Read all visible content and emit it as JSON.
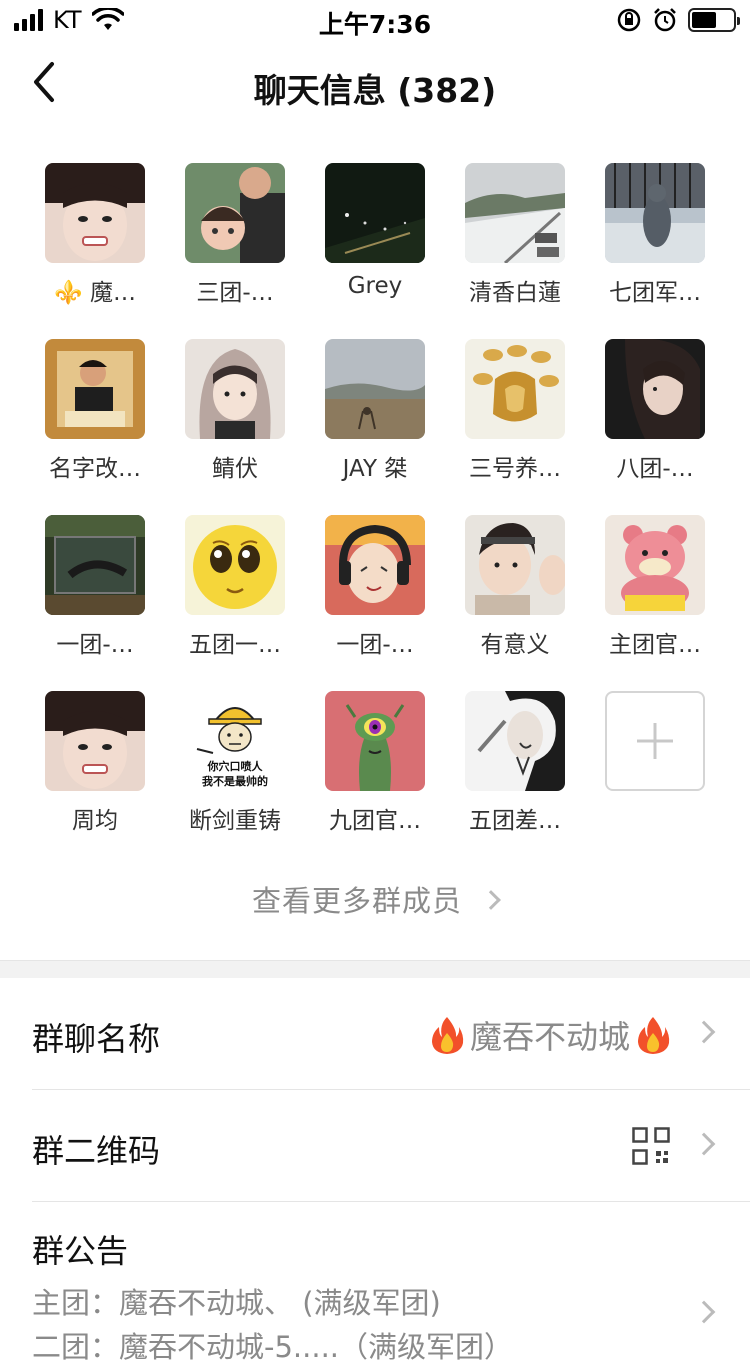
{
  "status_bar": {
    "carrier": "KT",
    "time": "上午7:36"
  },
  "nav": {
    "title": "聊天信息 (382)"
  },
  "members": [
    {
      "name": "⚜️ 魔…"
    },
    {
      "name": "三团-…"
    },
    {
      "name": "Grey"
    },
    {
      "name": "清香白蓮"
    },
    {
      "name": "七团军…"
    },
    {
      "name": "名字改…"
    },
    {
      "name": "鲭伏"
    },
    {
      "name": "JAY 桀"
    },
    {
      "name": "三号养…"
    },
    {
      "name": "八团-…"
    },
    {
      "name": "一团-…"
    },
    {
      "name": "五团一…"
    },
    {
      "name": "一团-…"
    },
    {
      "name": "有意义"
    },
    {
      "name": "主团官…"
    },
    {
      "name": "周均"
    },
    {
      "name": "断剑重铸"
    },
    {
      "name": "九团官…"
    },
    {
      "name": "五团差…"
    }
  ],
  "meme_caption": {
    "line1": "你穴口喷人",
    "line2": "我不是最帅的"
  },
  "view_more": "查看更多群成员",
  "settings": {
    "group_name": {
      "label": "群聊名称",
      "value": "魔吞不动城"
    },
    "group_qr": {
      "label": "群二维码"
    },
    "announcement": {
      "label": "群公告",
      "line1": "主团：魔吞不动城、          (满级军团)",
      "line2": "二团：魔吞不动城-5.....（满级军团）"
    }
  }
}
